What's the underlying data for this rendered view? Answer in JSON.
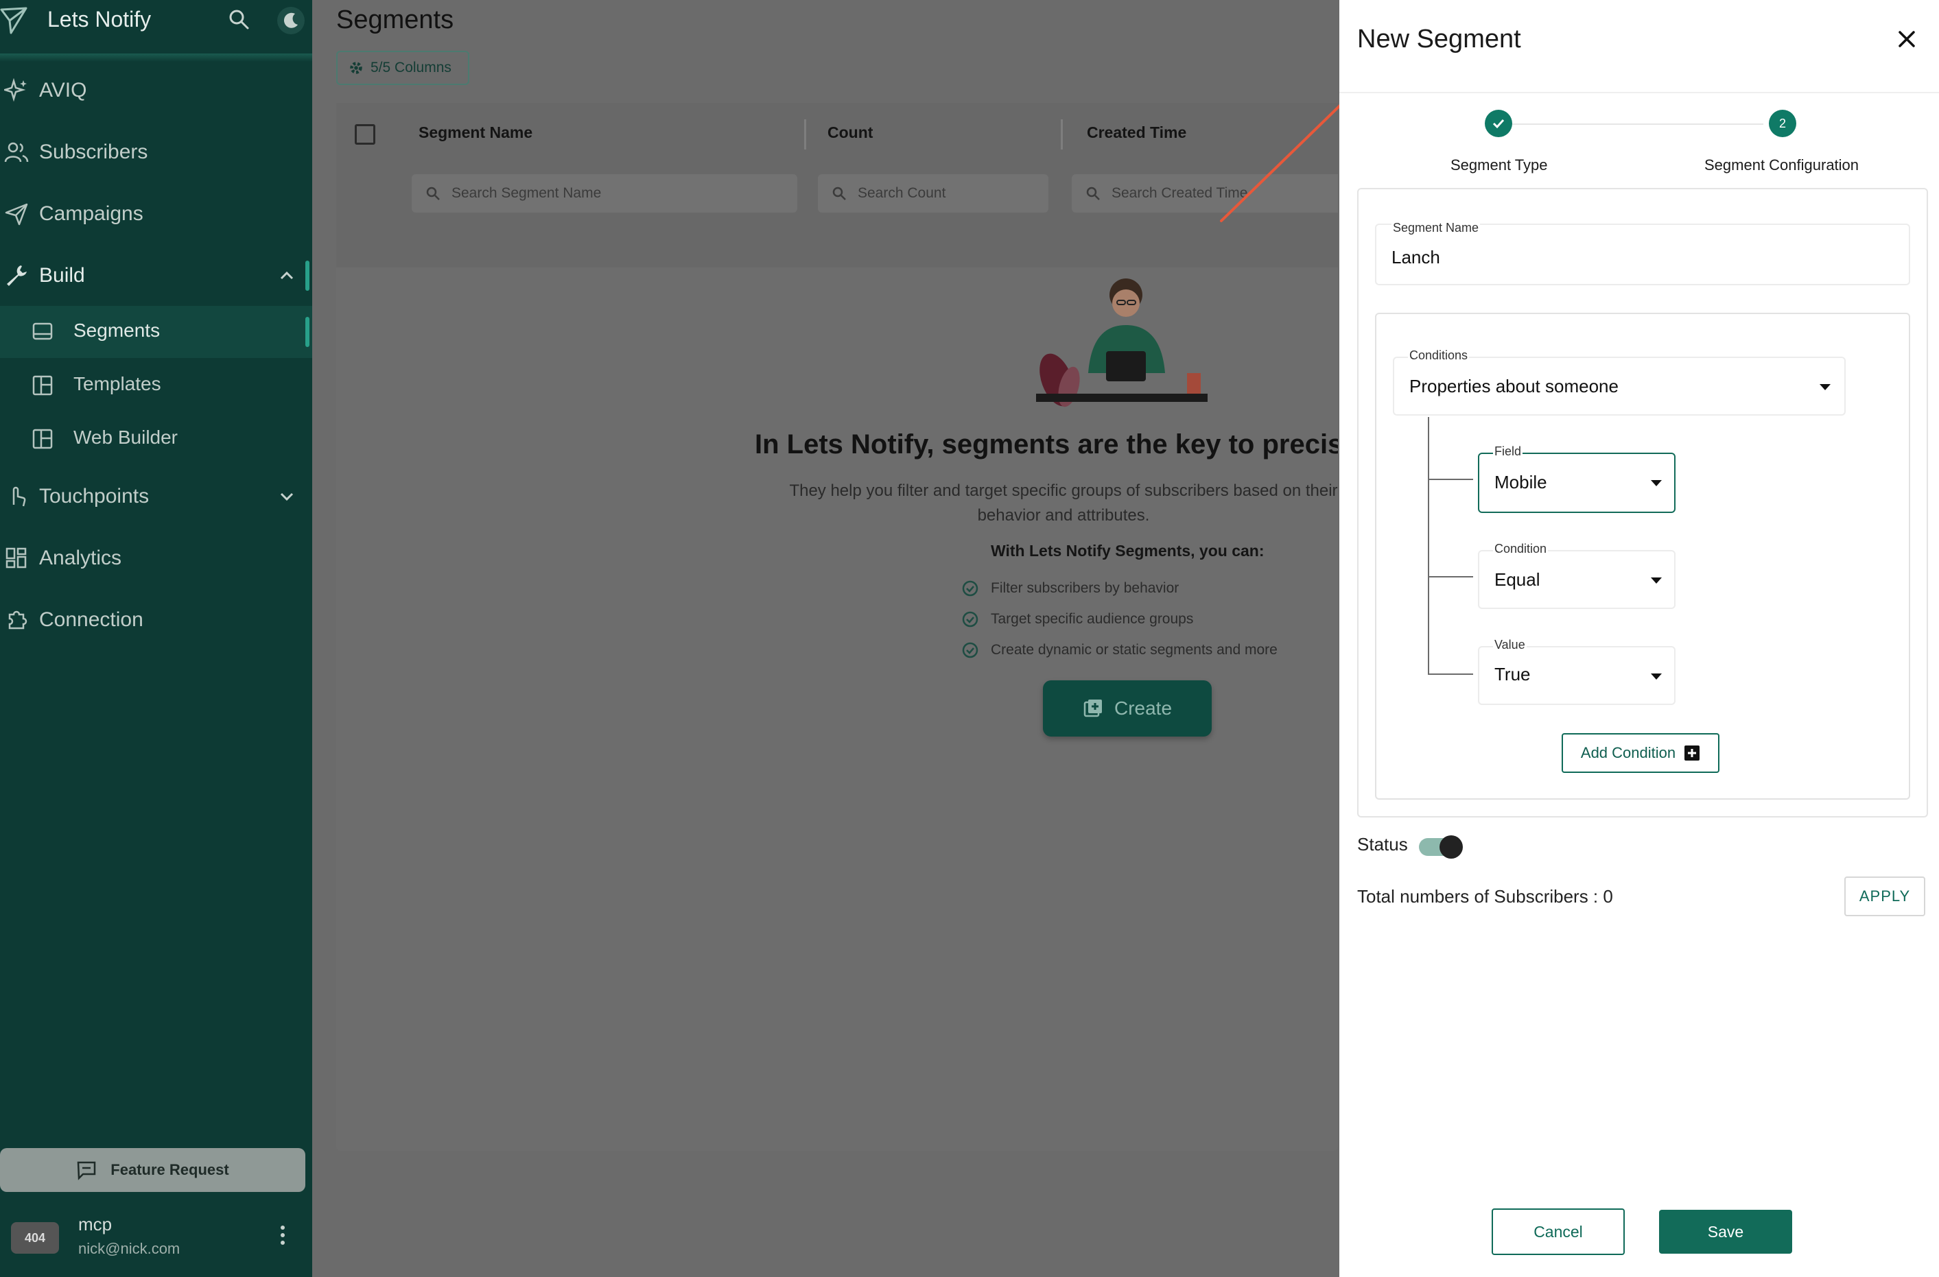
{
  "app": {
    "name": "Lets Notify"
  },
  "sidebar": {
    "items": [
      {
        "label": "AVIQ"
      },
      {
        "label": "Subscribers"
      },
      {
        "label": "Campaigns"
      },
      {
        "label": "Build"
      },
      {
        "label": "Touchpoints"
      },
      {
        "label": "Analytics"
      },
      {
        "label": "Connection"
      }
    ],
    "build_sub": [
      {
        "label": "Segments"
      },
      {
        "label": "Templates"
      },
      {
        "label": "Web Builder"
      }
    ],
    "feature_request": "Feature Request",
    "user": {
      "avatar_text": "404",
      "name": "mcp",
      "email": "nick@nick.com"
    }
  },
  "main": {
    "title": "Segments",
    "columns_button": "5/5 Columns",
    "table": {
      "headers": [
        "Segment Name",
        "Count",
        "Created Time"
      ],
      "filters": [
        "Search Segment Name",
        "Search Count",
        "Search Created Time"
      ]
    },
    "empty": {
      "title": "In Lets Notify, segments are the key to precision",
      "description": "They help you filter and target specific groups of subscribers based on their behavior and attributes.",
      "subtitle": "With Lets Notify Segments, you can:",
      "bullets": [
        "Filter subscribers by behavior",
        "Target specific audience groups",
        "Create dynamic or static segments and more"
      ],
      "create_button": "Create"
    }
  },
  "modal": {
    "title": "New Segment",
    "steps": [
      {
        "label": "Segment Type",
        "number": ""
      },
      {
        "label": "Segment Configuration",
        "number": "2"
      }
    ],
    "segment_name": {
      "label": "Segment Name",
      "value": "Lanch"
    },
    "conditions": {
      "label": "Conditions",
      "value": "Properties about someone"
    },
    "field": {
      "label": "Field",
      "value": "Mobile"
    },
    "condition": {
      "label": "Condition",
      "value": "Equal"
    },
    "value": {
      "label": "Value",
      "value": "True"
    },
    "add_condition": "Add Condition",
    "status_label": "Status",
    "total_subscribers": "Total numbers of Subscribers : 0",
    "apply_button": "APPLY",
    "cancel_button": "Cancel",
    "save_button": "Save"
  },
  "colors": {
    "sidebar_bg": "#0d3a34",
    "accent": "#0f7a66",
    "save_bg": "#126b59",
    "annotation_arrow": "#e8583a"
  }
}
